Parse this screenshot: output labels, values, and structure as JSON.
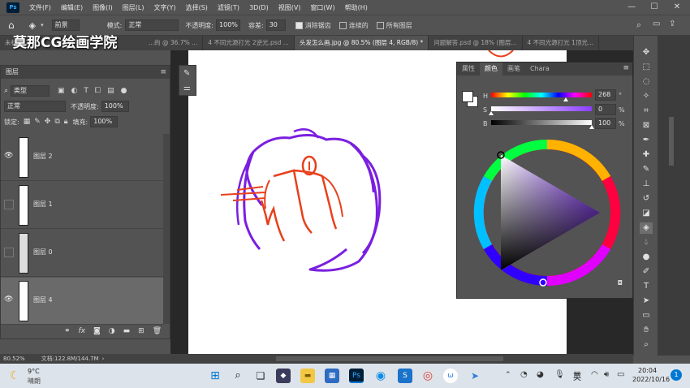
{
  "menubar": {
    "logo": "Ps",
    "items": [
      "文件(F)",
      "编辑(E)",
      "图像(I)",
      "图层(L)",
      "文字(Y)",
      "选择(S)",
      "滤镜(T)",
      "3D(D)",
      "视图(V)",
      "窗口(W)",
      "帮助(H)"
    ],
    "minimize": "—",
    "maximize": "☐",
    "close": "✕"
  },
  "options": {
    "preset": "前景",
    "mode_label": "模式:",
    "mode_value": "正常",
    "opacity_label": "不透明度:",
    "opacity_value": "100%",
    "tolerance_label": "容差:",
    "tolerance_value": "30",
    "antialias_label": "消除锯齿",
    "contiguous_label": "连续的",
    "all_layers_label": "所有图层"
  },
  "tabs": [
    {
      "label": "未标题-2",
      "active": false
    },
    {
      "label": "...的 @ 36.7% ...",
      "active": false
    },
    {
      "label": "4 不同光源打光 2逆光.psd ...",
      "active": false
    },
    {
      "label": "头发怎么画.jpg @ 80.5% (图层 4, RGB/8) *",
      "active": true
    },
    {
      "label": "问题解答.psd @ 18% (图层...",
      "active": false
    },
    {
      "label": "4 不同光源打光 1顶光...",
      "active": false
    }
  ],
  "watermark": "莫那CG绘画学院",
  "layers_panel": {
    "title": "图层",
    "filter_label": "类型",
    "blend_mode": "正常",
    "opacity_label": "不透明度:",
    "opacity_value": "100%",
    "lock_label": "锁定:",
    "fill_label": "填充:",
    "fill_value": "100%",
    "layers": [
      {
        "name": "图层 2",
        "visible": true,
        "selected": false
      },
      {
        "name": "图层 1",
        "visible": false,
        "selected": false
      },
      {
        "name": "图层 0",
        "visible": false,
        "selected": false
      },
      {
        "name": "图层 4",
        "visible": true,
        "selected": true
      }
    ],
    "footer_icons": [
      "link-icon",
      "fx-icon",
      "mask-icon",
      "adjustment-icon",
      "folder-icon",
      "new-layer-icon",
      "trash-icon"
    ]
  },
  "color_panel": {
    "tabs": [
      "属性",
      "颜色",
      "画笔",
      "Chara"
    ],
    "active_tab": "颜色",
    "h_label": "H",
    "h_value": "268",
    "h_unit": "°",
    "s_label": "S",
    "s_value": "0",
    "s_unit": "%",
    "b_label": "B",
    "b_value": "100",
    "b_unit": "%",
    "foreground": "#ffffff",
    "background": "#ffffff"
  },
  "status": {
    "zoom": "80.52%",
    "doc_info": "文档:122.8M/144.7M"
  },
  "taskbar": {
    "weather_temp": "9°C",
    "weather_desc": "晴朗",
    "lang": "英",
    "time": "20:04",
    "date": "2022/10/16",
    "notification_count": "1"
  },
  "colors": {
    "accent_purple": "#7a1fe0",
    "accent_red": "#e8401c"
  }
}
